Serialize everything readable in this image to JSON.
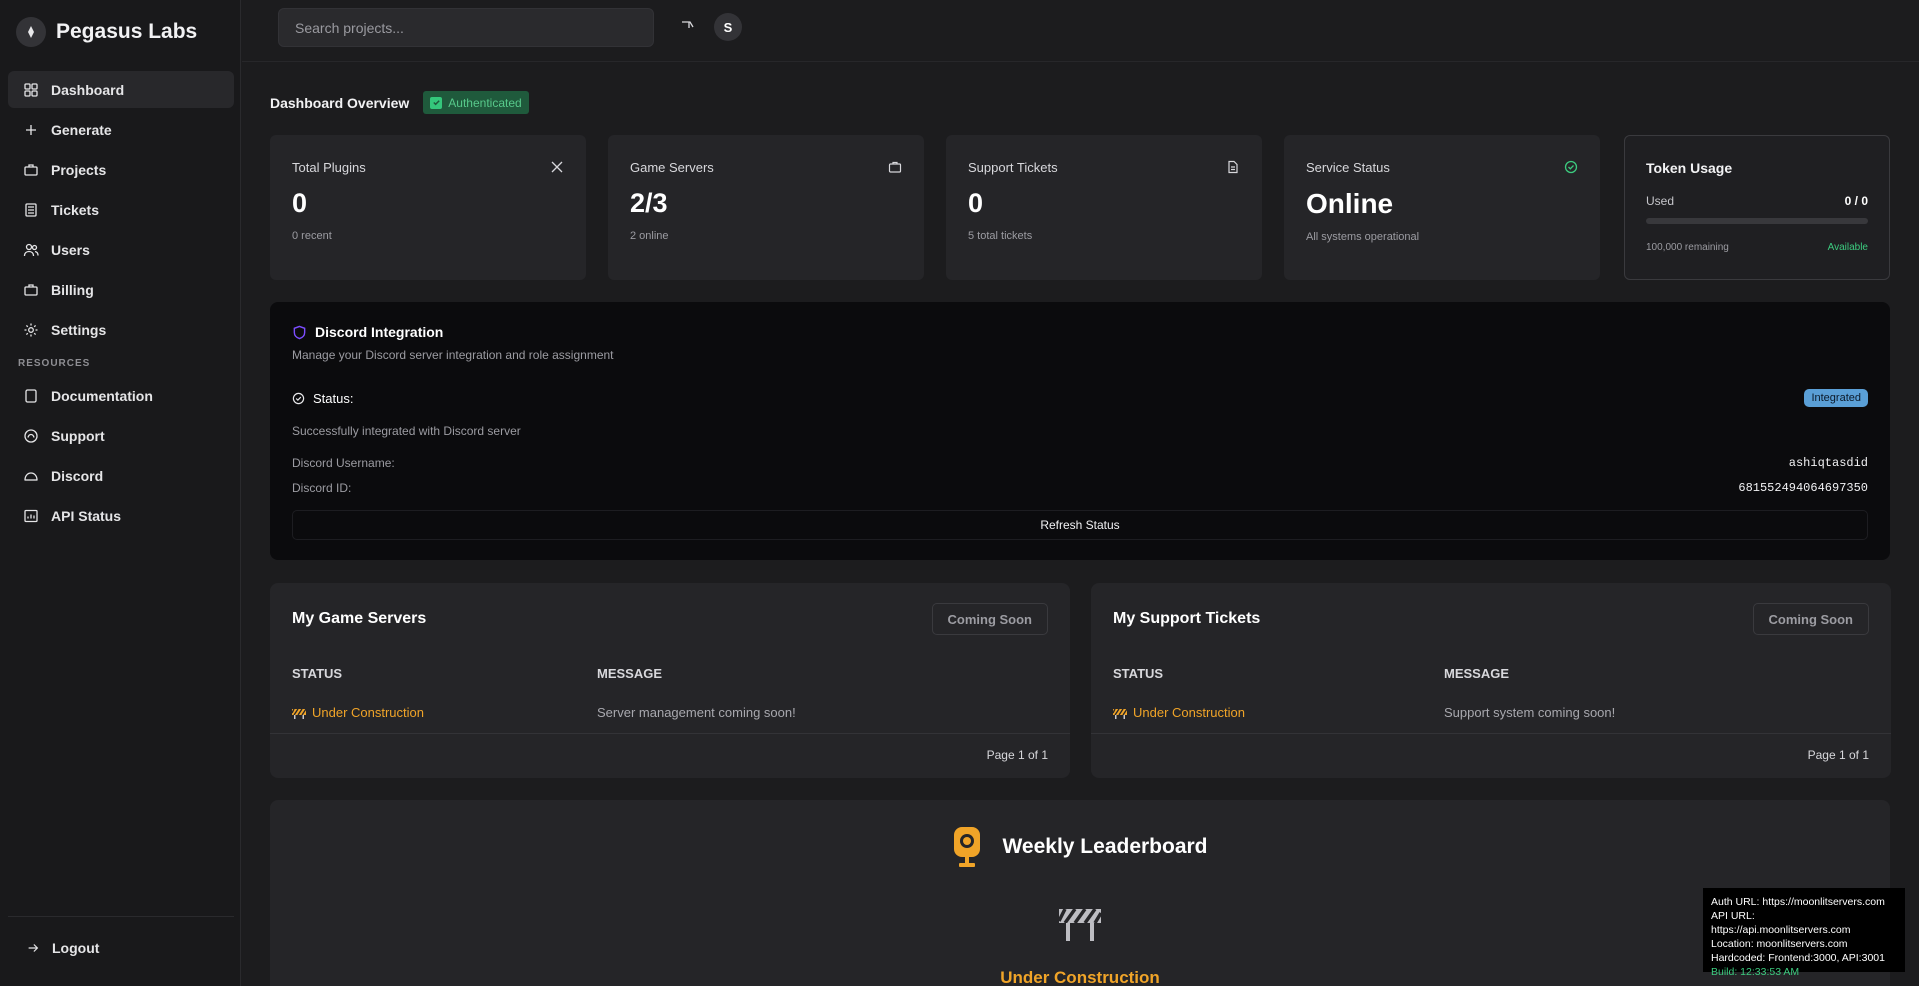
{
  "app": {
    "name": "Pegasus Labs"
  },
  "sidebar": {
    "items": [
      {
        "label": "Dashboard",
        "icon": "grid-icon",
        "active": true
      },
      {
        "label": "Generate",
        "icon": "plus-icon"
      },
      {
        "label": "Projects",
        "icon": "briefcase-icon"
      },
      {
        "label": "Tickets",
        "icon": "ticket-icon"
      },
      {
        "label": "Users",
        "icon": "users-icon"
      },
      {
        "label": "Billing",
        "icon": "briefcase-icon"
      },
      {
        "label": "Settings",
        "icon": "gear-icon"
      }
    ],
    "resources_heading": "RESOURCES",
    "resources": [
      {
        "label": "Documentation",
        "icon": "book-icon"
      },
      {
        "label": "Support",
        "icon": "support-icon"
      },
      {
        "label": "Discord",
        "icon": "discord-icon"
      },
      {
        "label": "API Status",
        "icon": "monitor-icon"
      }
    ],
    "logout_label": "Logout"
  },
  "header": {
    "search_placeholder": "Search projects...",
    "avatar_initial": "S"
  },
  "dashboard": {
    "title": "Dashboard Overview",
    "auth_badge": "Authenticated",
    "stats": [
      {
        "label": "Total Plugins",
        "value": "0",
        "sub": "0 recent",
        "icon": "x-icon"
      },
      {
        "label": "Game Servers",
        "value": "2/3",
        "sub": "2 online",
        "icon": "server-icon"
      },
      {
        "label": "Support Tickets",
        "value": "0",
        "sub": "5 total tickets",
        "icon": "document-icon"
      },
      {
        "label": "Service Status",
        "value": "Online",
        "sub": "All systems operational",
        "icon": "check-circle-icon"
      }
    ],
    "token_usage": {
      "title": "Token Usage",
      "used_label": "Used",
      "used_value": "0 / 0",
      "used_fraction": 0,
      "remaining": "100,000 remaining",
      "availability": "Available"
    }
  },
  "discord": {
    "title": "Discord Integration",
    "description": "Manage your Discord server integration and role assignment",
    "status_label": "Status:",
    "status_badge": "Integrated",
    "message": "Successfully integrated with Discord server",
    "username_label": "Discord Username:",
    "username": "ashiqtasdid",
    "id_label": "Discord ID:",
    "id": "681552494064697350",
    "refresh_label": "Refresh Status"
  },
  "game_servers": {
    "title": "My Game Servers",
    "button": "Coming Soon",
    "col_status": "STATUS",
    "col_message": "MESSAGE",
    "row_status": "Under Construction",
    "row_message": "Server management coming soon!",
    "pager": "Page 1 of 1"
  },
  "support_tickets": {
    "title": "My Support Tickets",
    "button": "Coming Soon",
    "col_status": "STATUS",
    "col_message": "MESSAGE",
    "row_status": "Under Construction",
    "row_message": "Support system coming soon!",
    "pager": "Page 1 of 1"
  },
  "leaderboard": {
    "title": "Weekly Leaderboard",
    "status": "Under Construction"
  },
  "debug": {
    "auth_url": "Auth URL: https://moonlitservers.com",
    "api_url": "API URL: https://api.moonlitservers.com",
    "location": "Location: moonlitservers.com",
    "hardcoded": "Hardcoded: Frontend:3000, API:3001",
    "build": "Build: 12:33:53 AM"
  },
  "colors": {
    "accent_orange": "#f0a428",
    "success_green": "#3ccb7f",
    "integrated_blue": "#5a9fd6",
    "shield_purple": "#7c4dff"
  }
}
